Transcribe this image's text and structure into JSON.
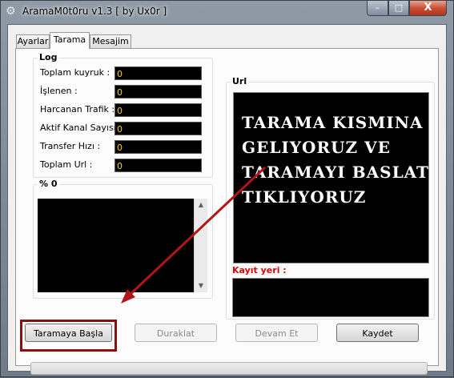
{
  "window": {
    "title": "AramaM0t0ru v1.3 [ by Ux0r ]",
    "icon": "gear-icon",
    "controls": {
      "minimize": "–",
      "maximize": "□",
      "close": "X"
    }
  },
  "tabs": [
    {
      "label": "Ayarlar",
      "selected": false
    },
    {
      "label": "Tarama",
      "selected": true
    },
    {
      "label": "Mesajim",
      "selected": false
    }
  ],
  "log": {
    "legend": "Log",
    "stats": [
      {
        "label": "Toplam kuyruk :",
        "value": "0"
      },
      {
        "label": "İşlenen :",
        "value": "0"
      },
      {
        "label": "Harcanan Trafik :",
        "value": "0"
      },
      {
        "label": "Aktif Kanal Sayısı :",
        "value": "0"
      },
      {
        "label": "Transfer Hızı :",
        "value": "0"
      },
      {
        "label": "Toplam Url :",
        "value": "0"
      }
    ]
  },
  "progress_group": {
    "legend": "% 0"
  },
  "url_group": {
    "legend": "Url",
    "overlay_text": "TARAMA KISMINA\nGELIYORUZ VE\nTARAMAYI BASLAT\nTIKLIYORUZ",
    "kayit_label": "Kayıt yeri :"
  },
  "buttons": {
    "start": "Taramaya Başla",
    "pause": "Duraklat",
    "resume": "Devam Et",
    "save": "Kaydet"
  },
  "progress": {
    "value": 0
  },
  "colors": {
    "stat_text": "#ffd200",
    "kayit_label": "#e00000",
    "annotation": "#8b1010"
  }
}
